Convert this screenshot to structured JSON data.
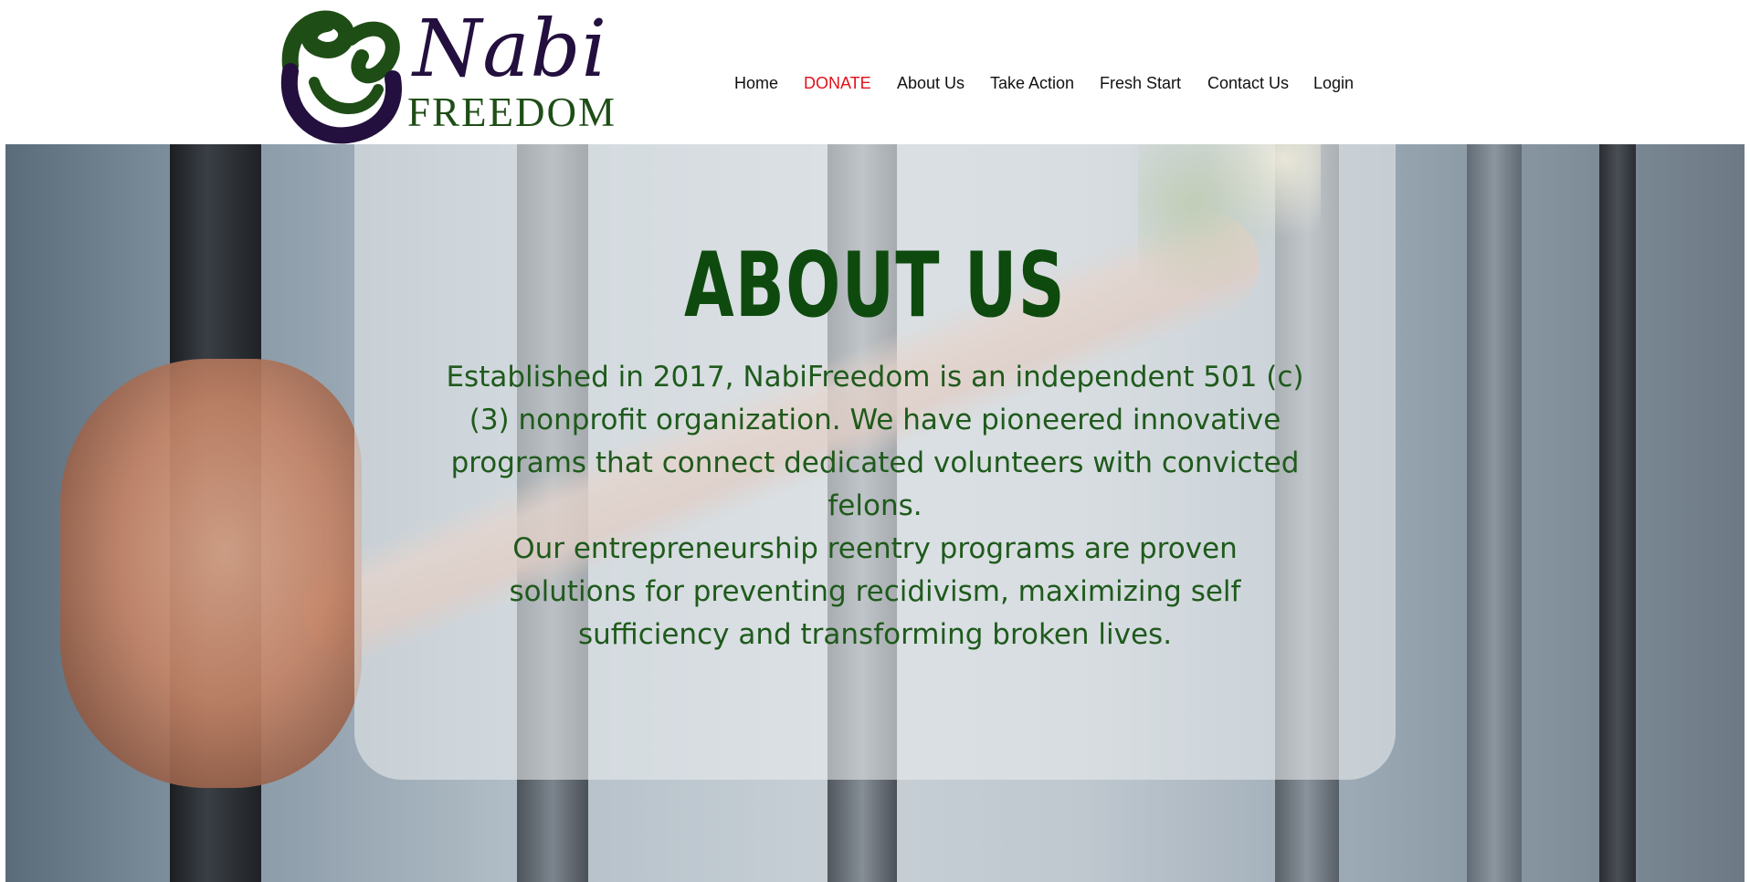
{
  "header": {
    "logo": {
      "word": "Nabi",
      "sub": "FREEDOM"
    },
    "nav": [
      {
        "label": "Home"
      },
      {
        "label": "DONATE"
      },
      {
        "label": "About Us"
      },
      {
        "label": "Take Action"
      },
      {
        "label": "Fresh Start"
      },
      {
        "label": "Contact Us"
      },
      {
        "label": "Login"
      }
    ]
  },
  "hero": {
    "title": "ABOUT US",
    "paragraphs": [
      "Established in 2017, NabiFreedom is an independent 501 (c)(3) nonprofit organization. We have pioneered innovative programs that connect dedicated volunteers with convicted felons.",
      "Our entrepreneurship reentry programs are proven solutions for preventing recidivism, maximizing self sufficiency and transforming broken lives."
    ]
  },
  "colors": {
    "nav_text": "#111111",
    "donate": "#e2101a",
    "title_green": "#0e4a0e",
    "body_green": "#1f5a1c",
    "logo_purple": "#23103e",
    "logo_green": "#1f4d16"
  }
}
